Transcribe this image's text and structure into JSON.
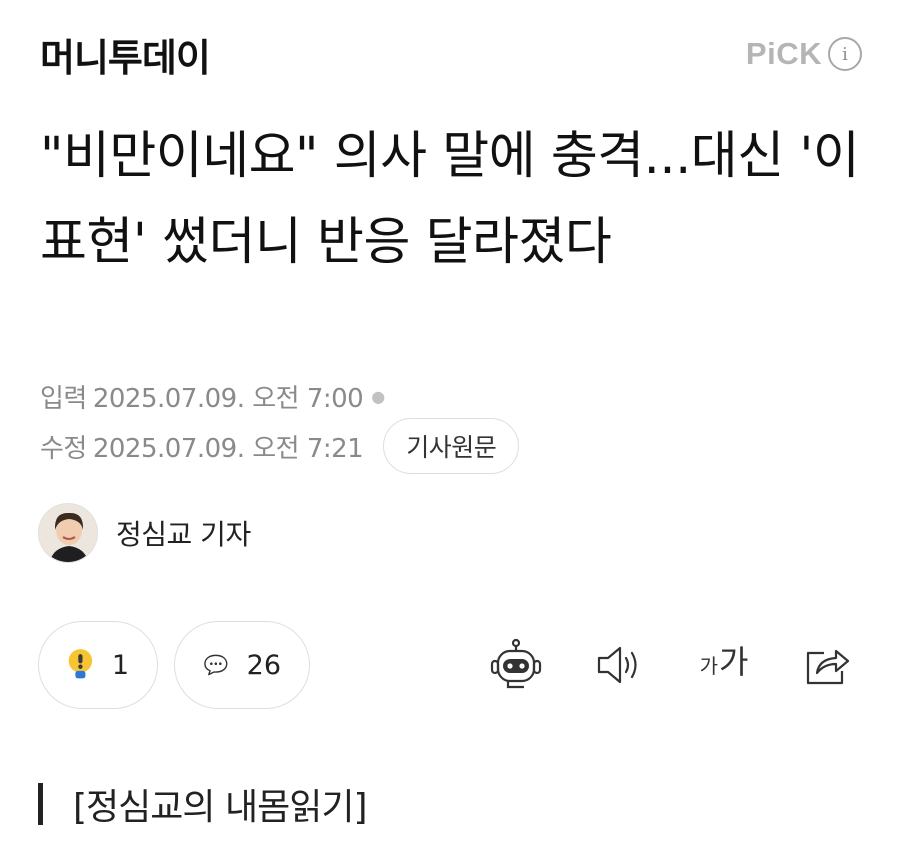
{
  "header": {
    "press_name": "머니투데이",
    "pick_label": "PiCK",
    "info_glyph": "i"
  },
  "article": {
    "headline": "\"비만이네요\" 의사 말에 충격...대신 '이 표현' 썼더니 반응 달라졌다",
    "published": {
      "label": "입력",
      "value": "2025.07.09. 오전 7:00"
    },
    "modified": {
      "label": "수정",
      "value": "2025.07.09. 오전 7:21"
    },
    "original_button": "기사원문",
    "reporter": "정심교 기자",
    "section_label": "[정심교의 내몸읽기]"
  },
  "actions": {
    "reaction_count": "1",
    "comment_count": "26",
    "font_size_small": "가",
    "font_size_large": "가"
  },
  "icons": {
    "reaction": "exclamation-bulb-icon",
    "comment": "speech-bubble-icon",
    "summary": "robot-icon",
    "tts": "speaker-icon",
    "share": "share-icon"
  },
  "colors": {
    "reaction_bulb": "#f7c531",
    "reaction_accent": "#2d78d6",
    "pick_gray": "#b5b5b5"
  }
}
